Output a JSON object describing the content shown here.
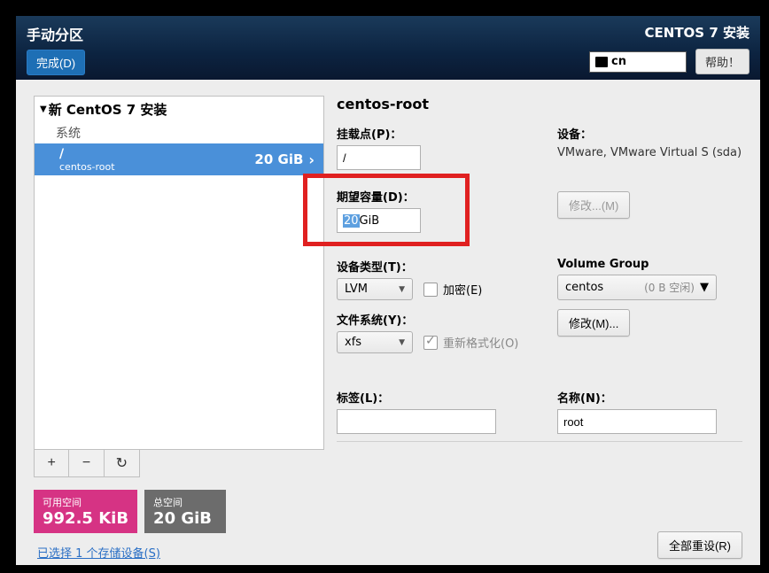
{
  "header": {
    "title": "手动分区",
    "done": "完成(D)",
    "brand": "CENTOS 7 安装",
    "lang": "cn",
    "help": "帮助！"
  },
  "tree": {
    "root_label": "新 CentOS 7 安装",
    "system_label": "系统",
    "selected": {
      "mount": "/",
      "device": "centos-root",
      "size": "20 GiB"
    }
  },
  "toolbar": {
    "add": "+",
    "remove": "−",
    "reload": "↻"
  },
  "space": {
    "avail_label": "可用空间",
    "avail_value": "992.5 KiB",
    "total_label": "总空间",
    "total_value": "20 GiB"
  },
  "link": "已选择 1 个存储设备(S)",
  "right": {
    "title": "centos-root",
    "mount_label": "挂载点(P)：",
    "mount_value": "/",
    "device_label": "设备：",
    "device_value": "VMware, VMware Virtual S (sda)",
    "modify_btn": "修改...(M)",
    "capacity_label": "期望容量(D)：",
    "capacity_num": "20",
    "capacity_unit": " GiB",
    "devtype_label": "设备类型(T)：",
    "devtype_value": "LVM",
    "encrypt_label": "加密(E)",
    "fs_label": "文件系统(Y)：",
    "fs_value": "xfs",
    "reformat_label": "重新格式化(O)",
    "vg_label": "Volume Group",
    "vg_value": "centos",
    "vg_free": "(0 B 空闲)",
    "vg_modify": "修改(M)...",
    "label_label": "标签(L)：",
    "label_value": "",
    "name_label": "名称(N)：",
    "name_value": "root",
    "reset_all": "全部重设(R)"
  }
}
